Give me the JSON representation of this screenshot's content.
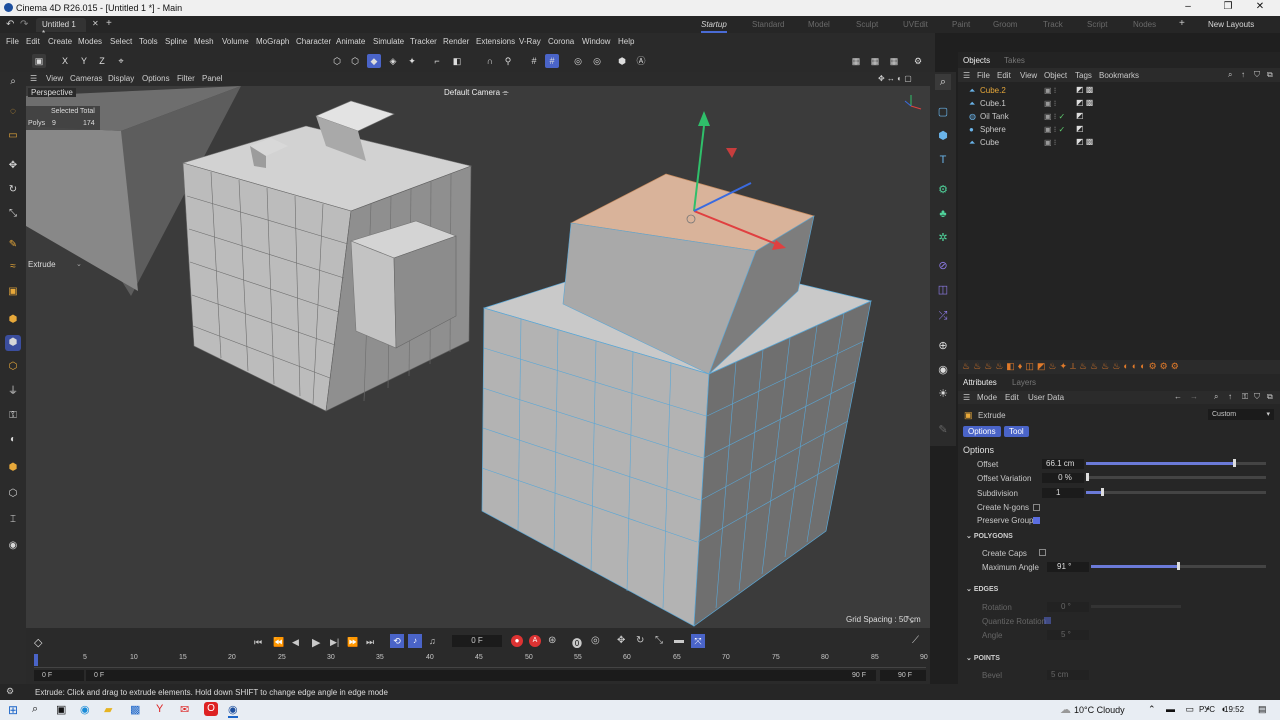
{
  "window": {
    "title": "Cinema 4D R26.015 - [Untitled 1 *] - Main"
  },
  "tabs": {
    "doc_tab": "Untitled 1 *"
  },
  "layouts": [
    "Startup",
    "Standard",
    "Model",
    "Sculpt",
    "UVEdit",
    "Paint",
    "Groom",
    "Track",
    "Script",
    "Nodes"
  ],
  "layout_active": "Startup",
  "new_layouts": "New Layouts",
  "menu": [
    "File",
    "Edit",
    "Create",
    "Modes",
    "Select",
    "Tools",
    "Spline",
    "Mesh",
    "Volume",
    "MoGraph",
    "Character",
    "Animate",
    "Simulate",
    "Tracker",
    "Render",
    "Extensions",
    "V-Ray",
    "Corona",
    "Window",
    "Help"
  ],
  "axis_lock": [
    "X",
    "Y",
    "Z"
  ],
  "viewport": {
    "menu": [
      "View",
      "Cameras",
      "Display",
      "Options",
      "Filter",
      "Panel"
    ],
    "name": "Perspective",
    "camera": "Default Camera",
    "hud_header": "Selected Total",
    "hud_label": "Polys",
    "hud_selected": "9",
    "hud_total": "174",
    "tool_label": "Extrude",
    "grid_spacing": "Grid Spacing : 50 cm"
  },
  "objects_panel": {
    "tabs": [
      "Objects",
      "Takes"
    ],
    "menu": [
      "File",
      "Edit",
      "View",
      "Object",
      "Tags",
      "Bookmarks"
    ],
    "items": [
      {
        "name": "Cube.2",
        "selected": true,
        "color": "#e7a83a"
      },
      {
        "name": "Cube.1",
        "selected": false,
        "color": "#d0d0d0"
      },
      {
        "name": "Oil Tank",
        "selected": false,
        "color": "#d0d0d0"
      },
      {
        "name": "Sphere",
        "selected": false,
        "color": "#d0d0d0"
      },
      {
        "name": "Cube",
        "selected": false,
        "color": "#d0d0d0"
      }
    ]
  },
  "attributes": {
    "tabs": [
      "Attributes",
      "Layers"
    ],
    "menu": [
      "Mode",
      "Edit",
      "User Data"
    ],
    "tool_name": "Extrude",
    "preset": "Custom",
    "subtabs": [
      "Options",
      "Tool"
    ],
    "section": "Options",
    "offset_label": "Offset",
    "offset_value": "66.1 cm",
    "offset_level": 0.82,
    "offset_var_label": "Offset Variation",
    "offset_var_value": "0 %",
    "subdiv_label": "Subdivision",
    "subdiv_value": "1",
    "ngons_label": "Create N-gons",
    "preserve_label": "Preserve Groups",
    "polygons_header": "POLYGONS",
    "caps_label": "Create Caps",
    "max_angle_label": "Maximum Angle",
    "max_angle_value": "91 °",
    "edges_header": "EDGES",
    "rotation_label": "Rotation",
    "rotation_value": "0 °",
    "quantize_label": "Quantize Rotation",
    "angle_label": "Angle",
    "angle_value": "5 °",
    "points_header": "POINTS",
    "bevel_label": "Bevel",
    "bevel_value": "5 cm"
  },
  "timeline": {
    "current_frame": "0 F",
    "ticks": [
      "0",
      "5",
      "10",
      "15",
      "20",
      "25",
      "30",
      "35",
      "40",
      "45",
      "50",
      "55",
      "60",
      "65",
      "70",
      "75",
      "80",
      "85",
      "90"
    ],
    "start": "0 F",
    "start2": "0 F",
    "end": "90 F",
    "end2": "90 F"
  },
  "status": {
    "text": "Extrude: Click and drag to extrude elements. Hold down SHIFT to change edge angle in edge mode"
  },
  "taskbar": {
    "weather": "10°C  Cloudy",
    "lang": "РУС",
    "time": "19:52"
  }
}
